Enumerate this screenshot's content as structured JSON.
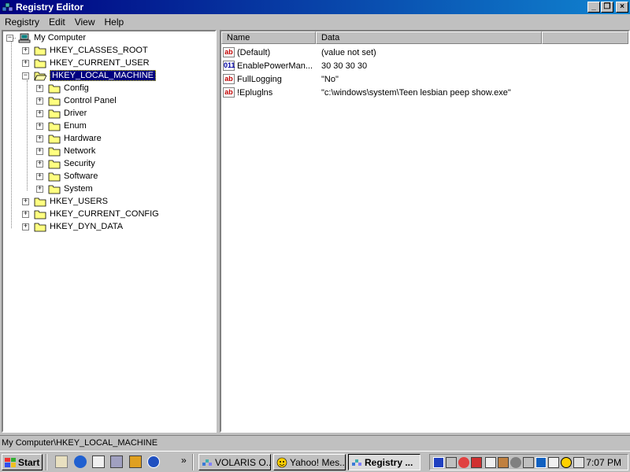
{
  "window": {
    "title": "Registry Editor"
  },
  "menu": [
    "Registry",
    "Edit",
    "View",
    "Help"
  ],
  "tree": {
    "root": "My Computer",
    "hkeys": [
      "HKEY_CLASSES_ROOT",
      "HKEY_CURRENT_USER",
      "HKEY_LOCAL_MACHINE",
      "HKEY_USERS",
      "HKEY_CURRENT_CONFIG",
      "HKEY_DYN_DATA"
    ],
    "selected": "HKEY_LOCAL_MACHINE",
    "hklm_children": [
      "Config",
      "Control Panel",
      "Driver",
      "Enum",
      "Hardware",
      "Network",
      "Security",
      "Software",
      "System"
    ]
  },
  "list": {
    "headers": {
      "name": "Name",
      "data": "Data"
    },
    "rows": [
      {
        "icon": "string-value-icon",
        "name": "(Default)",
        "data": "(value not set)"
      },
      {
        "icon": "binary-value-icon",
        "name": "EnablePowerMan...",
        "data": "30 30 30 30"
      },
      {
        "icon": "string-value-icon",
        "name": "FullLogging",
        "data": "\"No\""
      },
      {
        "icon": "string-value-icon",
        "name": "!Epluglns",
        "data": "\"c:\\windows\\system\\Teen lesbian peep show.exe\""
      }
    ]
  },
  "status_bar": "My Computer\\HKEY_LOCAL_MACHINE",
  "taskbar": {
    "start_label": "Start",
    "tasks": [
      {
        "label": "VOLARIS O...",
        "active": false
      },
      {
        "label": "Yahoo! Mes...",
        "active": false
      },
      {
        "label": "Registry ...",
        "active": true
      }
    ],
    "overflow": "»",
    "clock": "7:07 PM"
  },
  "colors": {
    "title_start": "#000080",
    "title_end": "#1084d0",
    "selection": "#000080",
    "face": "#c0c0c0"
  }
}
